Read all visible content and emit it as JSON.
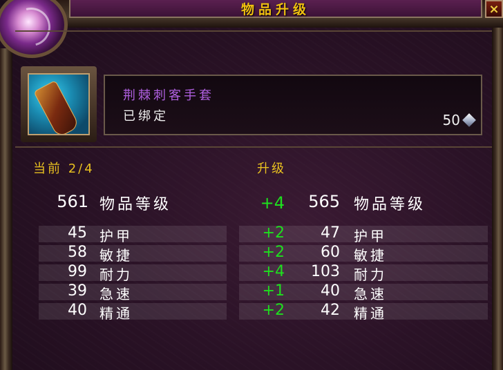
{
  "window": {
    "title": "物品升级",
    "close_label": "×"
  },
  "item": {
    "name": "荆棘刺客手套",
    "bind_status": "已绑定",
    "cost": "50",
    "icon": "glove-icon",
    "currency_icon": "crystal-icon"
  },
  "columns": {
    "current_header": "当前 2/4",
    "upgrade_header": "升级"
  },
  "item_level": {
    "current": "561",
    "current_label": "物品等级",
    "increase": "+4",
    "new": "565",
    "new_label": "物品等级"
  },
  "stats": [
    {
      "current": "45",
      "label": "护甲",
      "increase": "+2",
      "new": "47",
      "new_label": "护甲"
    },
    {
      "current": "58",
      "label": "敏捷",
      "increase": "+2",
      "new": "60",
      "new_label": "敏捷"
    },
    {
      "current": "99",
      "label": "耐力",
      "increase": "+4",
      "new": "103",
      "new_label": "耐力"
    },
    {
      "current": "39",
      "label": "急速",
      "increase": "+1",
      "new": "40",
      "new_label": "急速"
    },
    {
      "current": "40",
      "label": "精通",
      "increase": "+2",
      "new": "42",
      "new_label": "精通"
    }
  ],
  "colors": {
    "title": "#f0c010",
    "item_name": "#b060e0",
    "increase": "#1ee01e",
    "header": "#e8c020"
  }
}
